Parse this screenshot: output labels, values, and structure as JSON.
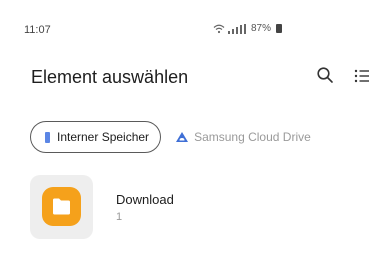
{
  "status_bar": {
    "time": "11:07",
    "battery": "87%",
    "icons": [
      "wifi-icon",
      "signal-icon",
      "battery-icon"
    ]
  },
  "header": {
    "title": "Element auswählen",
    "icons": [
      "search-icon",
      "list-view-icon"
    ]
  },
  "storage_tabs": [
    {
      "label": "Interner Speicher",
      "icon": "phone-storage-icon",
      "selected": true
    },
    {
      "label": "Samsung Cloud Drive",
      "icon": "cloud-icon",
      "selected": false
    }
  ],
  "folders": [
    {
      "name": "Download",
      "count": "1",
      "icon": "folder-icon"
    }
  ],
  "colors": {
    "accent_folder": "#f5a11b",
    "phone_icon": "#5b86e5",
    "cloud_icon": "#3f6fd6",
    "muted_text": "#9a9a9a"
  }
}
